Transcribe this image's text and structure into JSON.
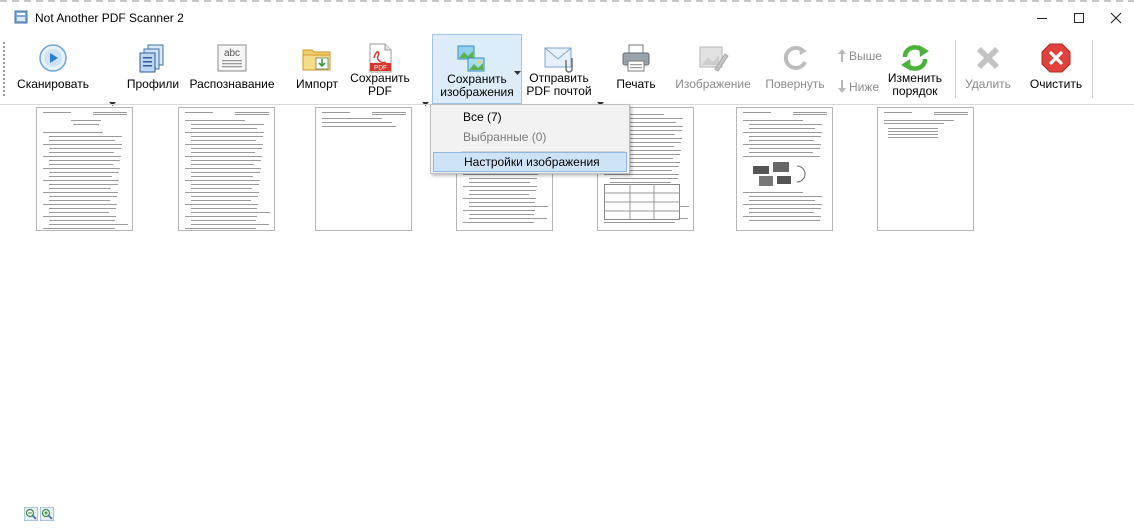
{
  "window": {
    "title": "Not Another PDF Scanner 2",
    "controls": [
      "minimize",
      "maximize",
      "close"
    ]
  },
  "toolbar": {
    "scan": "Сканировать",
    "profiles": "Профили",
    "ocr": "Распознавание",
    "import": "Импорт",
    "save_pdf_1": "Сохранить",
    "save_pdf_2": "PDF",
    "save_images_1": "Сохранить",
    "save_images_2": "изображения",
    "email_pdf_1": "Отправить",
    "email_pdf_2": "PDF почтой",
    "print": "Печать",
    "image": "Изображение",
    "rotate": "Повернуть",
    "move_up": "Выше",
    "move_down": "Ниже",
    "reorder_1": "Изменить",
    "reorder_2": "порядок",
    "delete": "Удалить",
    "clear": "Очистить",
    "ocr_icon_text": "abc",
    "pdf_icon_text": "PDF"
  },
  "save_images_menu": {
    "all": "Все (7)",
    "selected": "Выбранные (0)",
    "image_settings": "Настройки изображения"
  },
  "pages": {
    "count": 7
  },
  "colors": {
    "accent": "#1e6fd0",
    "menu_highlight": "#cfe3f7",
    "clear_red": "#e0413a",
    "reorder_green": "#4bb33a"
  }
}
